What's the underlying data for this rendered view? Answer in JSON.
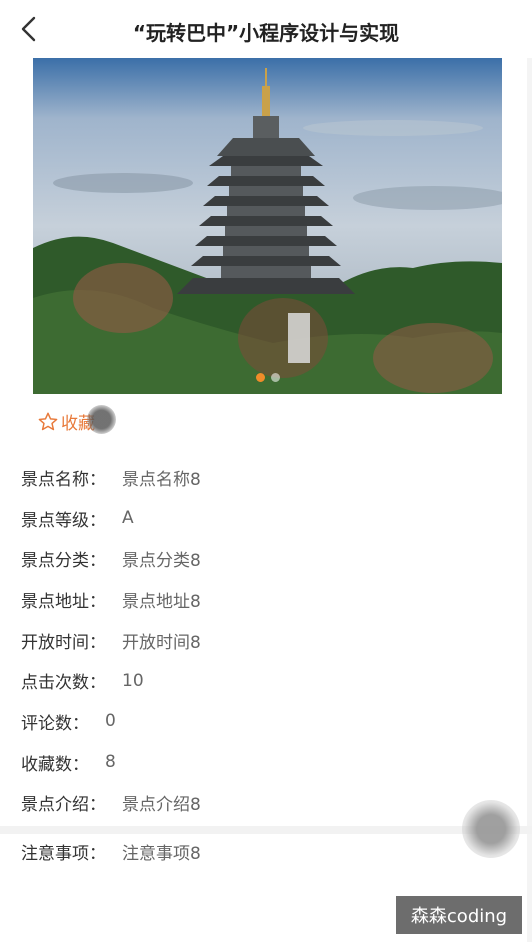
{
  "nav": {
    "title": "“玩转巴中”小程序设计与实现"
  },
  "banner": {
    "slides": 2,
    "active_index": 0
  },
  "favorite": {
    "label": "收藏"
  },
  "info": [
    {
      "key": "景点名称：",
      "value": "景点名称8"
    },
    {
      "key": "景点等级：",
      "value": "A"
    },
    {
      "key": "景点分类：",
      "value": "景点分类8"
    },
    {
      "key": "景点地址：",
      "value": "景点地址8"
    },
    {
      "key": "开放时间：",
      "value": "开放时间8"
    },
    {
      "key": "点击次数：",
      "value": "10"
    },
    {
      "key": "评论数：",
      "value": "0"
    },
    {
      "key": "收藏数：",
      "value": "8"
    },
    {
      "key": "景点介绍：",
      "value": "景点介绍8"
    }
  ],
  "notice": {
    "key": "注意事项：",
    "value": "注意事项8"
  },
  "watermark": "森森coding",
  "colors": {
    "accent": "#e8793a",
    "dot_active": "#f08c2a"
  }
}
